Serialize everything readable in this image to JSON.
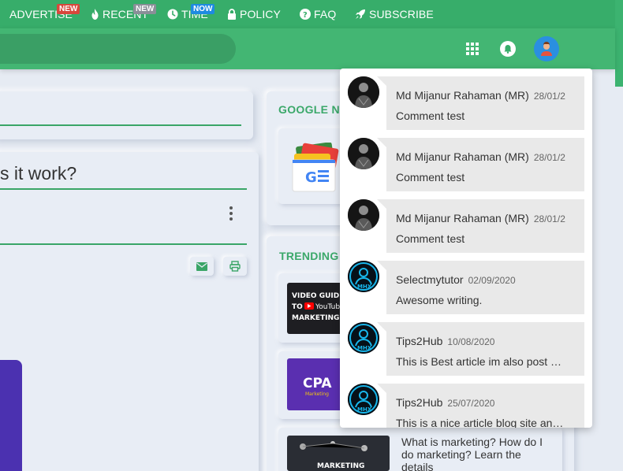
{
  "nav": {
    "items": [
      {
        "label": "ADVERTISE",
        "icon": "none",
        "badge": "NEW",
        "badge_color": "#d8473c"
      },
      {
        "label": "RECENT",
        "icon": "fire-icon",
        "badge": "NEW",
        "badge_color": "#8a8f98"
      },
      {
        "label": "TIME",
        "icon": "clock-icon",
        "badge": "NOW",
        "badge_color": "#1e8be0"
      },
      {
        "label": "POLICY",
        "icon": "lock-icon"
      },
      {
        "label": "FAQ",
        "icon": "question-circle-icon"
      },
      {
        "label": "SUBSCRIBE",
        "icon": "rocket-icon"
      }
    ]
  },
  "header_icons": [
    "grid-apps-icon",
    "bell-icon",
    "user-avatar-icon"
  ],
  "article": {
    "title_fragment": "s it work?"
  },
  "sidebar": {
    "google_title": "GOOGLE N",
    "trending_title": "TRENDING",
    "trending_items": [
      {
        "thumb_text": [
          "VIDEO GUID",
          "TO YouTub",
          "MARKETING"
        ]
      },
      {
        "thumb_text": [
          "CPA",
          "Marketing"
        ]
      },
      {
        "thumb_text": [
          "MARKETING"
        ],
        "title": "What is marketing? How do I do marketing? Learn the details"
      }
    ]
  },
  "colors": {
    "brand_green": "#37ad6a",
    "header_green": "#43b673",
    "purple": "#4b31b0"
  },
  "notifications": [
    {
      "name": "Md Mijanur Rahaman (MR)",
      "date": "28/01/2",
      "text": "Comment test",
      "avatar": "photo-avatar"
    },
    {
      "name": "Md Mijanur Rahaman (MR)",
      "date": "28/01/2",
      "text": "Comment test",
      "avatar": "photo-avatar"
    },
    {
      "name": "Md Mijanur Rahaman (MR)",
      "date": "28/01/2",
      "text": "Comment test",
      "avatar": "photo-avatar"
    },
    {
      "name": "Selectmytutor",
      "date": "02/09/2020",
      "text": "Awesome writing.",
      "avatar": "logo-avatar"
    },
    {
      "name": "Tips2Hub",
      "date": "10/08/2020",
      "text": "This is Best article im also post …",
      "avatar": "logo-avatar"
    },
    {
      "name": "Tips2Hub",
      "date": "25/07/2020",
      "text": "This is a nice article blog site an…",
      "avatar": "logo-avatar"
    }
  ]
}
